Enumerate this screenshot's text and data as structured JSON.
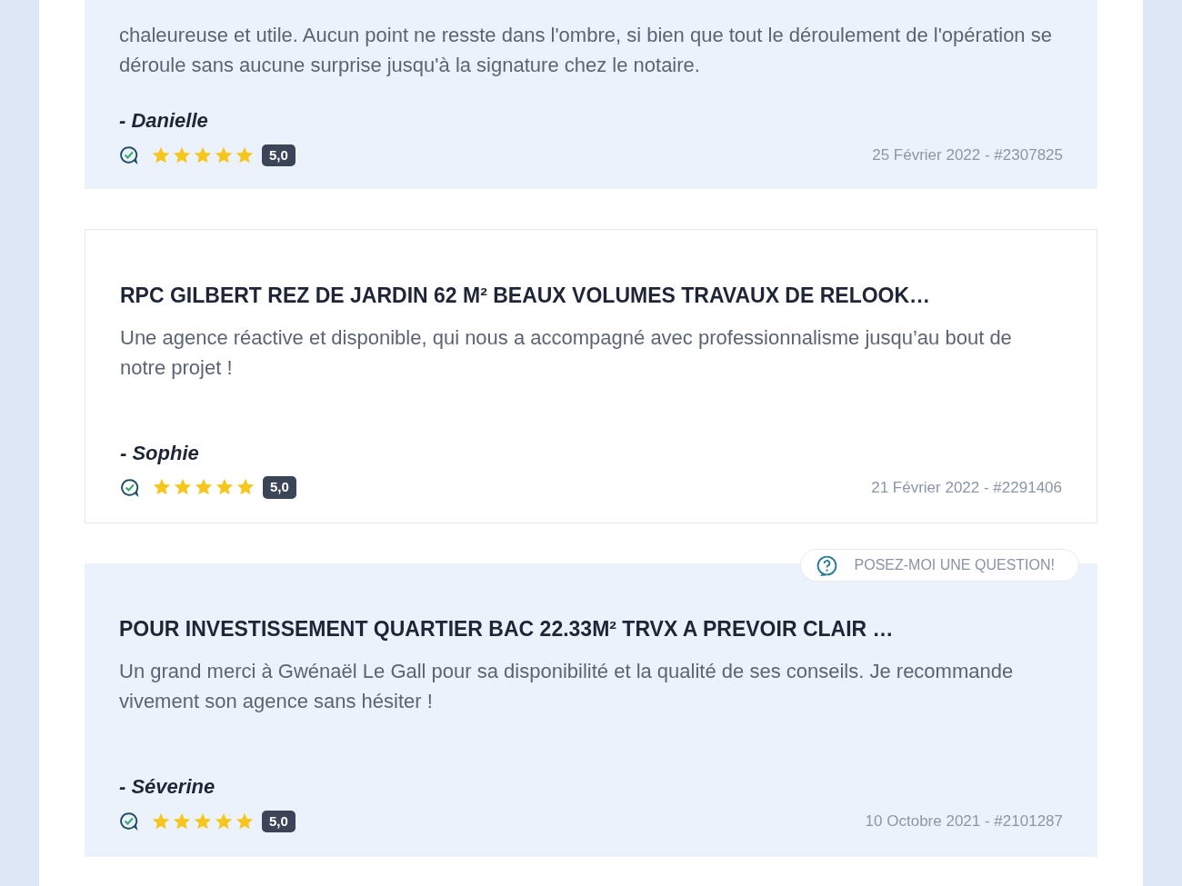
{
  "reviews": [
    {
      "text": "chaleureuse et utile. Aucun point ne resste dans l'ombre, si bien que tout le déroulement de l'opération se déroule sans aucune surprise jusqu'à la signature chez le notaire.",
      "author": "- Danielle",
      "stars": 5,
      "rating": "5,0",
      "meta": "25 Février 2022 - #2307825",
      "kind": "tinted"
    },
    {
      "title": "RPC GILBERT REZ DE JARDIN 62 M² BEAUX VOLUMES TRAVAUX DE RELOOK…",
      "text": "Une agence réactive et disponible, qui nous a accompagné avec professionnalisme jusqu’au bout de notre projet !",
      "author": "- Sophie",
      "stars": 5,
      "rating": "5,0",
      "meta": "21 Février 2022 - #2291406",
      "kind": "outlined"
    },
    {
      "title": "POUR INVESTISSEMENT QUARTIER BAC 22.33M² TRVX A PREVOIR CLAIR …",
      "text": "Un grand merci à Gwénaël Le Gall pour sa disponibilité et la qualité de ses conseils. Je recommande vivement son agence sans hésiter !",
      "author": "- Séverine",
      "stars": 5,
      "rating": "5,0",
      "meta": "10 Octobre 2021 - #2101287",
      "kind": "tinted"
    }
  ],
  "ask_button": {
    "label": "POSEZ-MOI UNE QUESTION!"
  }
}
